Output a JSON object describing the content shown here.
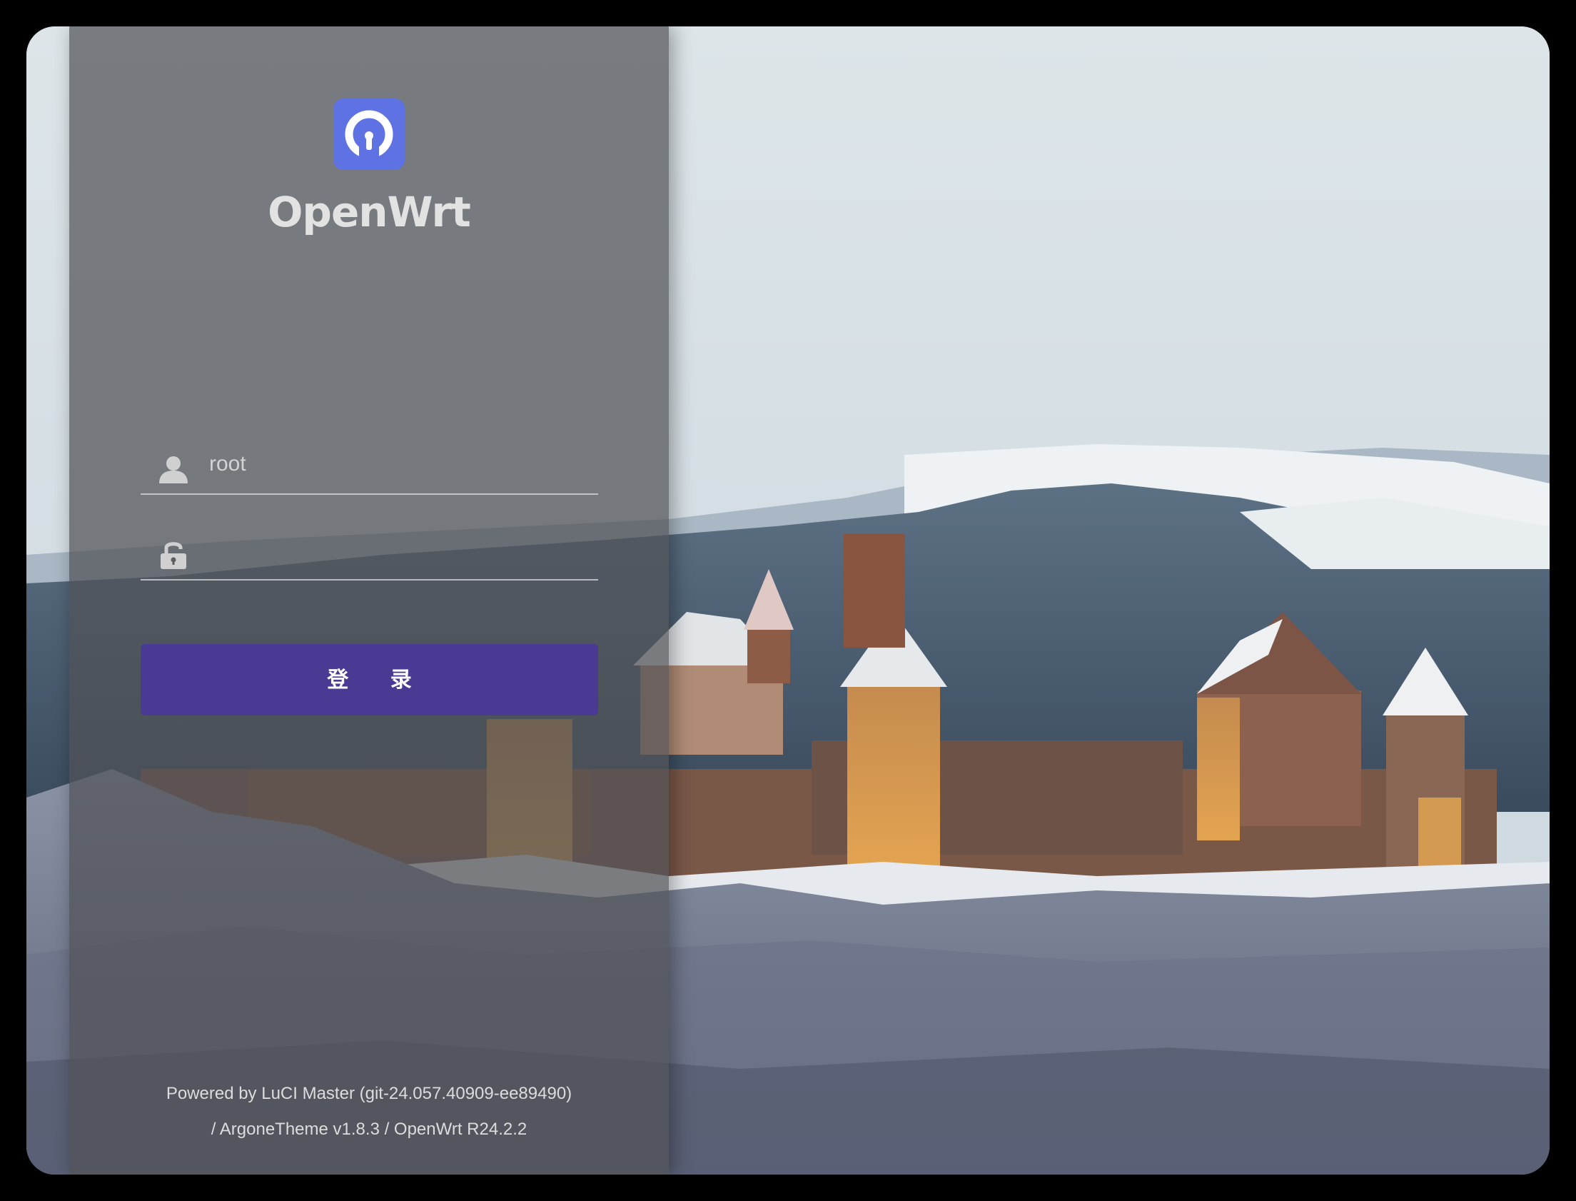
{
  "app": {
    "brand_name": "OpenWrt",
    "logo_icon": "openwrt-logo-icon"
  },
  "login": {
    "username_icon": "user-icon",
    "username_value": "root",
    "password_icon": "lock-icon",
    "password_value": "",
    "submit_label": "登 录"
  },
  "footer": {
    "line1": "Powered by LuCI Master (git-24.057.40909-ee89490)",
    "line2": "/ ArgoneTheme v1.8.3 / OpenWrt R24.2.2"
  },
  "colors": {
    "accent": "#5e72e4",
    "button": "#4a3a94",
    "panel": "#505256"
  }
}
